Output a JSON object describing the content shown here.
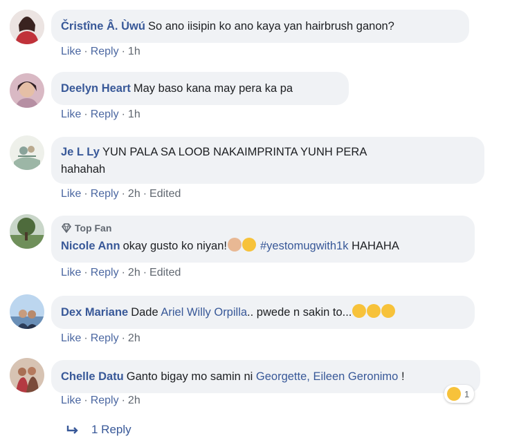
{
  "comments": [
    {
      "author": "Čristîne Â. Ùwú",
      "text": "So ano iisipin ko ano kaya yan hairbrush ganon?",
      "like": "Like",
      "reply": "Reply",
      "time": "1h"
    },
    {
      "author": "Deelyn Heart",
      "text": "May baso kana may pera ka pa",
      "like": "Like",
      "reply": "Reply",
      "time": "1h"
    },
    {
      "author": "Je L Ly",
      "text_line1": "YUN PALA SA LOOB NAKAIMPRINTA YUNH PERA",
      "text_line2": "hahahah",
      "like": "Like",
      "reply": "Reply",
      "time": "2h",
      "edited": "Edited"
    },
    {
      "badge": "Top Fan",
      "author": "Nicole Ann",
      "text": "okay gusto ko niyan!",
      "hashtag": "#yestomugwith1k",
      "text_after": "HAHAHA",
      "like": "Like",
      "reply": "Reply",
      "time": "2h",
      "edited": "Edited"
    },
    {
      "author": "Dex Mariane",
      "text_before": "Dade",
      "mention": "Ariel Willy Orpilla",
      "text_after": ".. pwede n sakin to...",
      "like": "Like",
      "reply": "Reply",
      "time": "2h"
    },
    {
      "author": "Chelle Datu",
      "text_before": "Ganto bigay mo samin ni",
      "mention1": "Georgette,",
      "mention2": "Eileen Geronimo",
      "text_after": "!",
      "reaction_count": "1",
      "like": "Like",
      "reply": "Reply",
      "time": "2h"
    }
  ],
  "replies_link": "1 Reply",
  "colors": {
    "link": "#385898",
    "bubble": "#f0f2f5",
    "meta": "#606770"
  },
  "icons": [
    "diamond-icon",
    "reply-arrow-icon",
    "laughing-emoji-icon",
    "wink-emoji-icon",
    "face-emoji-icon"
  ]
}
